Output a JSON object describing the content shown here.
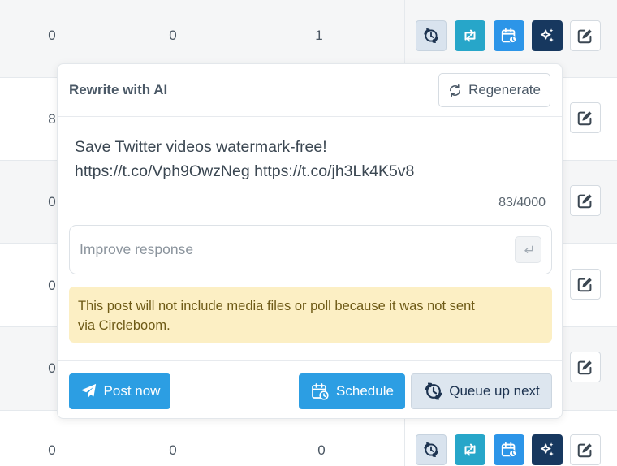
{
  "table": {
    "rows": [
      {
        "c1": "0",
        "c2": "0",
        "c3": "1"
      },
      {
        "c1": "8"
      },
      {
        "c1": "0"
      },
      {
        "c1": "0"
      },
      {
        "c1": "0"
      },
      {
        "c1": "0",
        "c2": "0",
        "c3": "0"
      }
    ]
  },
  "popover": {
    "title": "Rewrite with AI",
    "regenerate_label": "Regenerate",
    "tweet_line1": "Save Twitter videos watermark-free!",
    "tweet_line2": "https://t.co/Vph9OwzNeg https://t.co/jh3Lk4K5v8",
    "char_count": "83/4000",
    "improve_placeholder": "Improve response",
    "warning_line1": "This post will not include media files or poll because it was not sent",
    "warning_line2": "via Circleboom.",
    "post_now_label": "Post now",
    "schedule_label": "Schedule",
    "queue_label": "Queue up next"
  },
  "colors": {
    "primary": "#2c9ee3",
    "retweet": "#27a6c9",
    "ai": "#17385f",
    "warning_bg": "#fcefc4"
  },
  "icons": {
    "queue": "queue-clock-icon",
    "retweet": "retweet-icon",
    "calendar": "calendar-clock-icon",
    "ai": "sparkles-icon",
    "edit": "edit-icon",
    "regenerate": "refresh-icon",
    "enter": "enter-icon",
    "send": "send-icon"
  }
}
